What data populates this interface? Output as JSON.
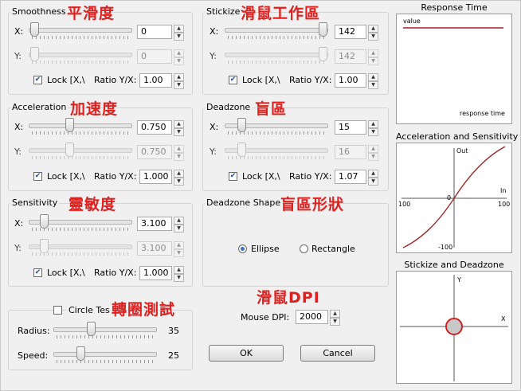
{
  "smoothness": {
    "title": "Smoothness",
    "title_cn": "平滑度",
    "x_label": "X:",
    "y_label": "Y:",
    "x_value": "0",
    "y_value": "0",
    "lock_label": "Lock [X,\\",
    "ratio_label": "Ratio Y/X:",
    "ratio_value": "1.00",
    "lock_checked": true
  },
  "stickize": {
    "title": "Stickize",
    "title_cn": "滑鼠工作區",
    "x_label": "X:",
    "y_label": "Y:",
    "x_value": "142",
    "y_value": "142",
    "lock_label": "Lock [X,\\",
    "ratio_label": "Ratio Y/X:",
    "ratio_value": "1.00",
    "lock_checked": true
  },
  "acceleration": {
    "title": "Acceleration",
    "title_cn": "加速度",
    "x_label": "X:",
    "y_label": "Y:",
    "x_value": "0.750",
    "y_value": "0.750",
    "lock_label": "Lock [X,\\",
    "ratio_label": "Ratio Y/X:",
    "ratio_value": "1.000",
    "lock_checked": true
  },
  "deadzone": {
    "title": "Deadzone",
    "title_cn": "盲區",
    "x_label": "X:",
    "y_label": "Y:",
    "x_value": "15",
    "y_value": "16",
    "lock_label": "Lock [X,\\",
    "ratio_label": "Ratio Y/X:",
    "ratio_value": "1.07",
    "lock_checked": true
  },
  "sensitivity": {
    "title": "Sensitivity",
    "title_cn": "靈敏度",
    "x_label": "X:",
    "y_label": "Y:",
    "x_value": "3.100",
    "y_value": "3.100",
    "lock_label": "Lock [X,\\",
    "ratio_label": "Ratio Y/X:",
    "ratio_value": "1.000",
    "lock_checked": true
  },
  "deadzone_shape": {
    "title": "Deadzone Shape",
    "title_cn": "盲區形狀",
    "option_ellipse": "Ellipse",
    "option_rectangle": "Rectangle",
    "selected": "Ellipse"
  },
  "circle_test": {
    "label": "Circle Tes",
    "title_cn": "轉圈測試",
    "checked": false,
    "radius_label": "Radius:",
    "radius_value": "35",
    "speed_label": "Speed:",
    "speed_value": "25"
  },
  "mouse_dpi": {
    "title_cn": "滑鼠DPI",
    "label": "Mouse DPI:",
    "value": "2000"
  },
  "buttons": {
    "ok": "OK",
    "cancel": "Cancel"
  },
  "response_time": {
    "title": "Response Time",
    "value_label": "value",
    "axis_label": "response time"
  },
  "accel_sensitivity": {
    "title": "Acceleration and Sensitivity",
    "out_label": "Out",
    "in_label": "In",
    "x_min": "100",
    "x_max": "100",
    "y_zero": "0",
    "y_min": "-100"
  },
  "stickize_deadzone": {
    "title": "Stickize and Deadzone",
    "y_label": "Y",
    "x_label": "X"
  },
  "colors": {
    "annotation": "#e0201e",
    "curve": "#a02020",
    "deadzone_fill": "#c8c8c8",
    "deadzone_ring": "#d02020",
    "accent": "#3a70c8"
  }
}
